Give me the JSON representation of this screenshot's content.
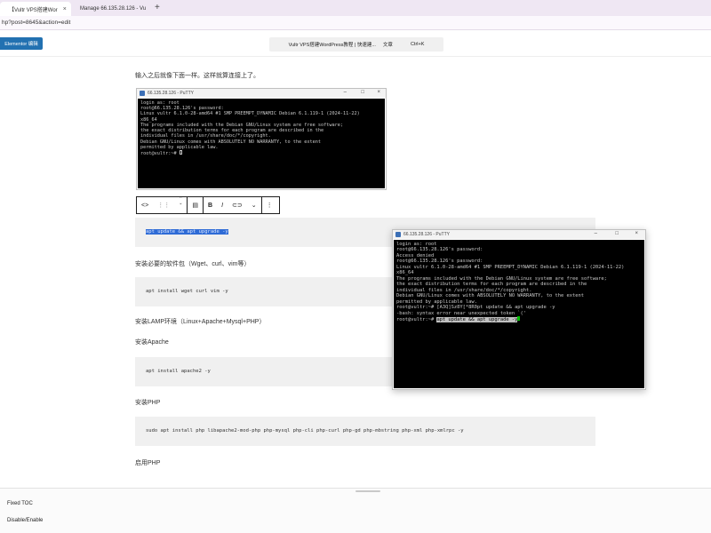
{
  "browser": {
    "tabs": [
      {
        "title": "【Vultr VPS搭建Wor",
        "active": true
      },
      {
        "title": "Manage 66.135.28.126 - Vu",
        "active": false
      }
    ],
    "new_tab": "+",
    "url": "hp?post=8645&action=edit"
  },
  "editor": {
    "elementor_label": "Elementor 编辑",
    "doc_title": "Vultr VPS搭建WordPress教程 | 快速建...",
    "doc_type": "文章",
    "shortcut": "Ctrl+K"
  },
  "content": {
    "intro": "输入之后就像下面一样。这样就算连接上了。",
    "selected_code": "apt update && apt upgrade -y",
    "heading_tools": "安装必要的软件包（Wget、curl、vim等）",
    "code_tools": "apt install wget curl vim -y",
    "heading_lamp": "安装LAMP环境（Linux+Apache+Mysql+PHP）",
    "heading_apache": "安装Apache",
    "code_apache": "apt install apache2 -y",
    "heading_php": "安装PHP",
    "code_php": "sudo apt install php libapache2-mod-php php-mysql php-cli php-curl php-gd php-mbstring php-xml php-xmlrpc -y",
    "heading_enable_php": "启用PHP"
  },
  "putty_small": {
    "title": "66.135.28.126 - PuTTY",
    "lines": [
      "login as: root",
      "root@66.135.28.126's password:",
      "Linux vultr 6.1.0-28-amd64 #1 SMP PREEMPT_DYNAMIC Debian 6.1.119-1 (2024-11-22)",
      "x86_64",
      "",
      "The programs included with the Debian GNU/Linux system are free software;",
      "the exact distribution terms for each program are described in the",
      "individual files in /usr/share/doc/*/copyright.",
      "",
      "Debian GNU/Linux comes with ABSOLUTELY NO WARRANTY, to the extent",
      "permitted by applicable law.",
      "root@vultr:~# "
    ]
  },
  "putty_large": {
    "title": "66.135.28.126 - PuTTY",
    "lines": [
      "login as: root",
      "root@66.135.28.126's password:",
      "Access denied",
      "root@66.135.28.126's password:",
      "Linux vultr 6.1.0-28-amd64 #1 SMP PREEMPT_DYNAMIC Debian 6.1.119-1 (2024-11-22)",
      "x86_64",
      "",
      "The programs included with the Debian GNU/Linux system are free software;",
      "the exact distribution terms for each program are described in the",
      "individual files in /usr/share/doc/*/copyright.",
      "",
      "Debian GNU/Linux comes with ABSOLUTELY NO WARRANTY, to the extent",
      "permitted by applicable law.",
      "root@vultr:~# [A3Q]Sz8Y[*8R0pt update && apt upgrade -y",
      "-bash: syntax error near unexpected token `('",
      "root@vultr:~# "
    ],
    "last_command": "apt update && apt upgrade -y"
  },
  "bottom_panel": {
    "fixed_toc": "Fixed TOC",
    "toggle": "Disable/Enable"
  },
  "colors": {
    "accent": "#2271b1",
    "selection": "#2e6bd6",
    "terminal_bg": "#000000",
    "cursor_green": "#00c000"
  }
}
